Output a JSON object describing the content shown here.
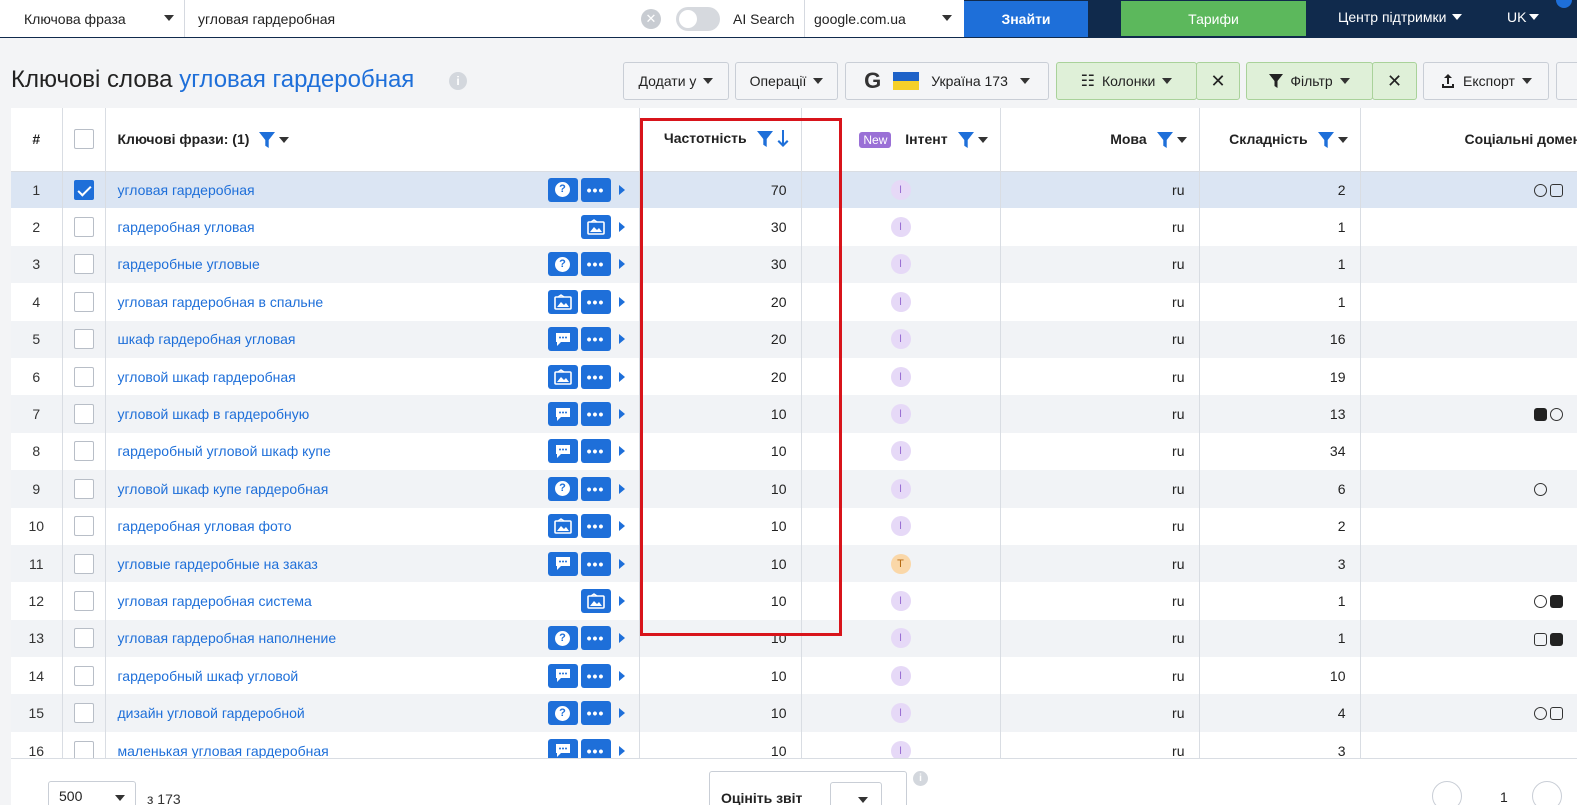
{
  "topbar": {
    "keyword_type": "Ключова фраза",
    "search_value": "угловая гардеробная",
    "ai_search_label": "AI Search",
    "engine": "google.com.ua",
    "find_label": "Знайти",
    "plans_label": "Тарифи",
    "support_label": "Центр підтримки",
    "lang_label": "UK"
  },
  "title": {
    "prefix": "Ключові слова",
    "query": "угловая гардеробная"
  },
  "toolbar": {
    "add_to": "Додати у",
    "operations": "Операції",
    "region": "Україна 173",
    "columns": "Колонки",
    "filter": "Фільтр",
    "export": "Експорт"
  },
  "table": {
    "headers": {
      "num": "#",
      "keyword": "Ключові фрази: (1)",
      "frequency": "Частотність",
      "new_badge": "New",
      "intent": "Інтент",
      "language": "Мова",
      "difficulty": "Складність",
      "social": "Соціальні домени"
    },
    "rows": [
      {
        "n": "1",
        "kw": "угловая гардеробная",
        "freq": "70",
        "intent": "I",
        "lang": "ru",
        "diff": "2"
      },
      {
        "n": "2",
        "kw": "гардеробная угловая",
        "freq": "30",
        "intent": "I",
        "lang": "ru",
        "diff": "1"
      },
      {
        "n": "3",
        "kw": "гардеробные угловые",
        "freq": "30",
        "intent": "I",
        "lang": "ru",
        "diff": "1"
      },
      {
        "n": "4",
        "kw": "угловая гардеробная в спальне",
        "freq": "20",
        "intent": "I",
        "lang": "ru",
        "diff": "1"
      },
      {
        "n": "5",
        "kw": "шкаф гардеробная угловая",
        "freq": "20",
        "intent": "I",
        "lang": "ru",
        "diff": "16"
      },
      {
        "n": "6",
        "kw": "угловой шкаф гардеробная",
        "freq": "20",
        "intent": "I",
        "lang": "ru",
        "diff": "19"
      },
      {
        "n": "7",
        "kw": "угловой шкаф в гардеробную",
        "freq": "10",
        "intent": "I",
        "lang": "ru",
        "diff": "13"
      },
      {
        "n": "8",
        "kw": "гардеробный угловой шкаф купе",
        "freq": "10",
        "intent": "I",
        "lang": "ru",
        "diff": "34"
      },
      {
        "n": "9",
        "kw": "угловой шкаф купе гардеробная",
        "freq": "10",
        "intent": "I",
        "lang": "ru",
        "diff": "6"
      },
      {
        "n": "10",
        "kw": "гардеробная угловая фото",
        "freq": "10",
        "intent": "I",
        "lang": "ru",
        "diff": "2"
      },
      {
        "n": "11",
        "kw": "угловые гардеробные на заказ",
        "freq": "10",
        "intent": "T",
        "lang": "ru",
        "diff": "3"
      },
      {
        "n": "12",
        "kw": "угловая гардеробная система",
        "freq": "10",
        "intent": "I",
        "lang": "ru",
        "diff": "1"
      },
      {
        "n": "13",
        "kw": "угловая гардеробная наполнение",
        "freq": "10",
        "intent": "I",
        "lang": "ru",
        "diff": "1"
      },
      {
        "n": "14",
        "kw": "гардеробный шкаф угловой",
        "freq": "10",
        "intent": "I",
        "lang": "ru",
        "diff": "10"
      },
      {
        "n": "15",
        "kw": "дизайн угловой гардеробной",
        "freq": "10",
        "intent": "I",
        "lang": "ru",
        "diff": "4"
      },
      {
        "n": "16",
        "kw": "маленькая угловая гардеробная",
        "freq": "10",
        "intent": "I",
        "lang": "ru",
        "diff": "3"
      }
    ]
  },
  "footer": {
    "per_page": "500",
    "of_total": "з 173",
    "rate_report": "Оцініть звіт",
    "page": "1"
  },
  "colors": {
    "accent": "#1e6fd9",
    "topbar": "#102a4c",
    "green": "#5cb85c",
    "highlight_box": "#d8141b"
  }
}
